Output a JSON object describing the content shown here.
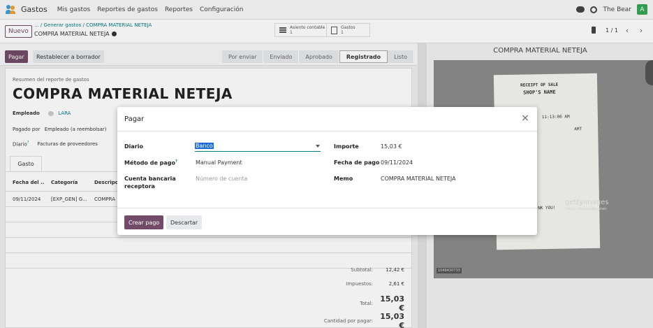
{
  "topbar": {
    "app_name": "Gastos",
    "menu": [
      "Mis gastos",
      "Reportes de gastos",
      "Reportes",
      "Configuración"
    ],
    "user_name": "The Bear",
    "avatar_letter": "A"
  },
  "control": {
    "new_label": "Nuevo",
    "breadcrumb_parts": [
      "...",
      "/",
      "Generar gastos",
      "/",
      "COMPRA MATERIAL NETEJA"
    ],
    "record_title": "COMPRA MATERIAL NETEJA",
    "smart_buttons": [
      {
        "label": "Asiento contable",
        "count": "1"
      },
      {
        "label": "Gastos",
        "count": "1"
      }
    ],
    "pager": "1 / 1"
  },
  "statusbar": {
    "pay_label": "Pagar",
    "reset_label": "Restablecer a borrador",
    "stages": [
      "Por enviar",
      "Enviado",
      "Aprobado",
      "Registrado",
      "Listo"
    ],
    "active_stage": "Registrado"
  },
  "sheet": {
    "label": "Resumen del reporte de gastos",
    "title": "COMPRA MATERIAL NETEJA",
    "employee_label": "Empleado",
    "employee_value": "LARA",
    "paid_by_label": "Pagado por",
    "paid_by_value": "Empleado (a reembolsar)",
    "journal_label": "Diario",
    "journal_sup": "?",
    "journal_value": "Facturas de proveedores",
    "tab_label": "Gasto",
    "columns": [
      "Fecha del ...",
      "Categoría",
      "Descripc"
    ],
    "rows": [
      [
        "09/11/2024",
        "[EXP_GEN] G...",
        "COMPRA"
      ]
    ],
    "totals": [
      {
        "label": "Subtotal:",
        "value": "12,42 €",
        "big": false
      },
      {
        "label": "Impuestos:",
        "value": "2,61 €",
        "big": false
      },
      {
        "label": "Total:",
        "value": "15,03 €",
        "big": true
      },
      {
        "label": "Cantidad por pagar:",
        "value": "15,03 €",
        "big": true
      }
    ]
  },
  "attachment": {
    "title": "COMPRA MATERIAL NETEJA",
    "receipt_lines": [
      "RECEIPT OF SALE",
      "SHOP'S NAME",
      "11:13:06 AM",
      "AMT",
      "NK YOU!"
    ],
    "watermark": "gettyimages",
    "watermark_credit": "Credit: mustafabacalaki",
    "footer_id": "1049430733"
  },
  "modal": {
    "title": "Pagar",
    "diario_label": "Diario",
    "diario_value": "Banco",
    "metodo_label": "Método de pago",
    "metodo_sup": "?",
    "metodo_value": "Manual Payment",
    "cuenta_label": "Cuenta bancaria receptora",
    "cuenta_placeholder": "Número de cuenta",
    "importe_label": "Importe",
    "importe_value": "15,03 €",
    "fecha_label": "Fecha de pago",
    "fecha_value": "09/11/2024",
    "memo_label": "Memo",
    "memo_value": "COMPRA MATERIAL NETEJA",
    "create_label": "Crear pago",
    "discard_label": "Descartar"
  }
}
